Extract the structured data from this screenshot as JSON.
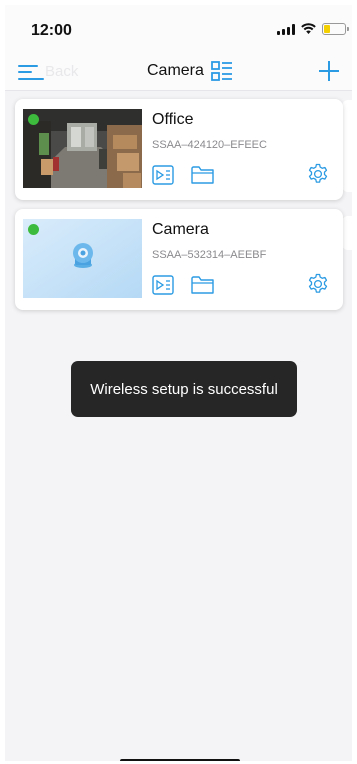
{
  "status_bar": {
    "time": "12:00",
    "battery_color": "#f5d000"
  },
  "nav": {
    "back_label": "Back",
    "title": "Camera",
    "menu_icon": "hamburger-menu-icon",
    "view_icon": "list-view-icon",
    "add_icon": "plus-icon",
    "accent": "#2b9be3"
  },
  "devices": [
    {
      "name": "Office",
      "uid": "SSAA–424120–EFEEC",
      "status": "online",
      "thumbnail": "live-snapshot"
    },
    {
      "name": "Camera",
      "uid": "SSAA–532314–AEEBF",
      "status": "online",
      "thumbnail": "camera-placeholder-icon"
    }
  ],
  "card_actions": [
    "playback-icon",
    "folder-icon",
    "settings-icon"
  ],
  "toast": {
    "message": "Wireless setup is successful"
  },
  "colors": {
    "online": "#3dbb3d",
    "toast_bg": "#262626"
  }
}
